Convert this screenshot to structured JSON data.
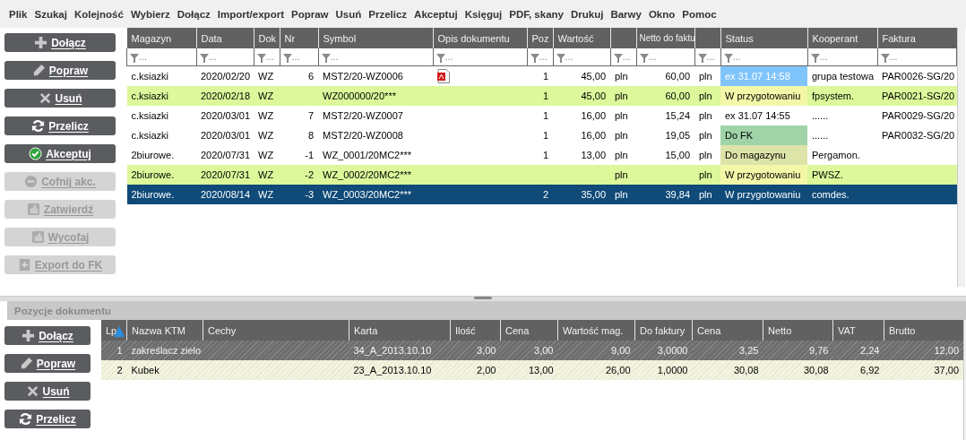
{
  "menu": [
    "Plik",
    "Szukaj",
    "Kolejność",
    "Wybierz",
    "Dołącz",
    "Import/export",
    "Popraw",
    "Usuń",
    "Przelicz",
    "Akceptuj",
    "Księguj",
    "PDF, skany",
    "Drukuj",
    "Barwy",
    "Okno",
    "Pomoc"
  ],
  "actions": [
    {
      "label": "Dołącz",
      "disabled": false
    },
    {
      "label": "Popraw",
      "disabled": false
    },
    {
      "label": "Usuń",
      "disabled": false
    },
    {
      "label": "Przelicz",
      "disabled": false
    },
    {
      "label": "Akceptuj",
      "disabled": false
    },
    {
      "label": "Cofnij akc.",
      "disabled": true
    },
    {
      "label": "Zatwierdź",
      "disabled": true
    },
    {
      "label": "Wycofaj",
      "disabled": true
    },
    {
      "label": "Export do FK",
      "disabled": true
    }
  ],
  "documents": {
    "columns": [
      {
        "label": "Magazyn"
      },
      {
        "label": "Data"
      },
      {
        "label": "Dok"
      },
      {
        "label": "Nr"
      },
      {
        "label": "Symbol"
      },
      {
        "label": "Opis dokumentu"
      },
      {
        "label": "Poz"
      },
      {
        "label": "Wartość"
      },
      {},
      {
        "label": "Netto do faktu"
      },
      {},
      {
        "label": "Status"
      },
      {
        "label": "Kooperant"
      },
      {
        "label": "Faktura"
      }
    ],
    "filter_placeholder": "...",
    "rows": [
      {
        "cells": [
          "c.ksiazki",
          "2020/02/20",
          "WZ",
          "6",
          "MST2/20-WZ0006",
          "",
          "1",
          "45,00",
          "pln",
          "60,00",
          "pln",
          "ex 31.07 14:58",
          "grupa testowa",
          "PAR0026-SG/20"
        ],
        "pdf": true,
        "highlighted": false,
        "selected": false,
        "color": "#80c4fc"
      },
      {
        "cells": [
          "c.ksiazki",
          "2020/02/18",
          "WZ",
          "",
          "WZ000000/20***",
          "",
          "1",
          "45,00",
          "pln",
          "60,00",
          "pln",
          "W przygotowaniu",
          "fpsystem.",
          "PAR0021-SG/20"
        ],
        "pdf": false,
        "highlighted": true,
        "selected": false,
        "color": "#f2f8a8"
      },
      {
        "cells": [
          "c.ksiazki",
          "2020/03/01",
          "WZ",
          "7",
          "MST2/20-WZ0007",
          "",
          "1",
          "16,00",
          "pln",
          "15,24",
          "pln",
          "ex 31.07 14:55",
          "......",
          "PAR0029-SG/20"
        ],
        "pdf": false,
        "highlighted": false,
        "selected": false
      },
      {
        "cells": [
          "c.ksiazki",
          "2020/03/01",
          "WZ",
          "8",
          "MST2/20-WZ0008",
          "",
          "1",
          "16,00",
          "pln",
          "19,05",
          "pln",
          "Do FK",
          "......",
          "PAR0032-SG/20"
        ],
        "pdf": false,
        "highlighted": false,
        "selected": false,
        "color": "#a0d4a8"
      },
      {
        "cells": [
          "2biurowe.",
          "2020/07/31",
          "WZ",
          "-1",
          "WZ_0001/20MC2***",
          "",
          "1",
          "13,00",
          "pln",
          "15,00",
          "pln",
          "Do magazynu",
          "Pergamon.",
          ""
        ],
        "pdf": false,
        "highlighted": false,
        "selected": false,
        "color": "#dde4a8"
      },
      {
        "cells": [
          "2biurowe.",
          "2020/07/31",
          "WZ",
          "-2",
          "WZ_0002/20MC2***",
          "",
          "",
          "",
          "pln",
          "",
          "pln",
          "W przygotowaniu",
          "PWSZ.",
          ""
        ],
        "pdf": false,
        "highlighted": true,
        "selected": false,
        "color": "#f2f8a8"
      },
      {
        "cells": [
          "2biurowe.",
          "2020/08/14",
          "WZ",
          "-3",
          "WZ_0003/20MC2***",
          "",
          "2",
          "35,00",
          "pln",
          "39,84",
          "pln",
          "W przygotowaniu",
          "comdes.",
          ""
        ],
        "pdf": false,
        "highlighted": false,
        "selected": true
      }
    ]
  },
  "positions_tab": "Pozycje dokumentu",
  "position_actions": [
    {
      "label": "Dołącz"
    },
    {
      "label": "Popraw"
    },
    {
      "label": "Usuń"
    },
    {
      "label": "Przelicz"
    }
  ],
  "positions": {
    "columns": [
      {
        "label": "Lp"
      },
      {
        "label": "Nazwa KTM"
      },
      {
        "label": "Cechy"
      },
      {
        "label": "Karta"
      },
      {
        "label": "Ilość"
      },
      {
        "label": "Cena"
      },
      {
        "label": "Wartość mag."
      },
      {
        "label": "Do faktury"
      },
      {
        "label": "Cena"
      },
      {
        "label": "Netto"
      },
      {
        "label": "VAT"
      },
      {
        "label": "Brutto"
      }
    ],
    "rows": [
      {
        "cells": [
          "1",
          "zakreślacz zielo",
          "",
          "34_A_2013.10.10",
          "3,00",
          "3,00",
          "9,00",
          "3,0000",
          "3,25",
          "9,76",
          "2,24",
          "12,00"
        ],
        "selected": true
      },
      {
        "cells": [
          "2",
          "Kubek",
          "",
          "23_A_2013.10.10",
          "2,00",
          "13,00",
          "26,00",
          "1,0000",
          "30,08",
          "30,08",
          "6,92",
          "37,00"
        ],
        "selected": false
      }
    ]
  }
}
